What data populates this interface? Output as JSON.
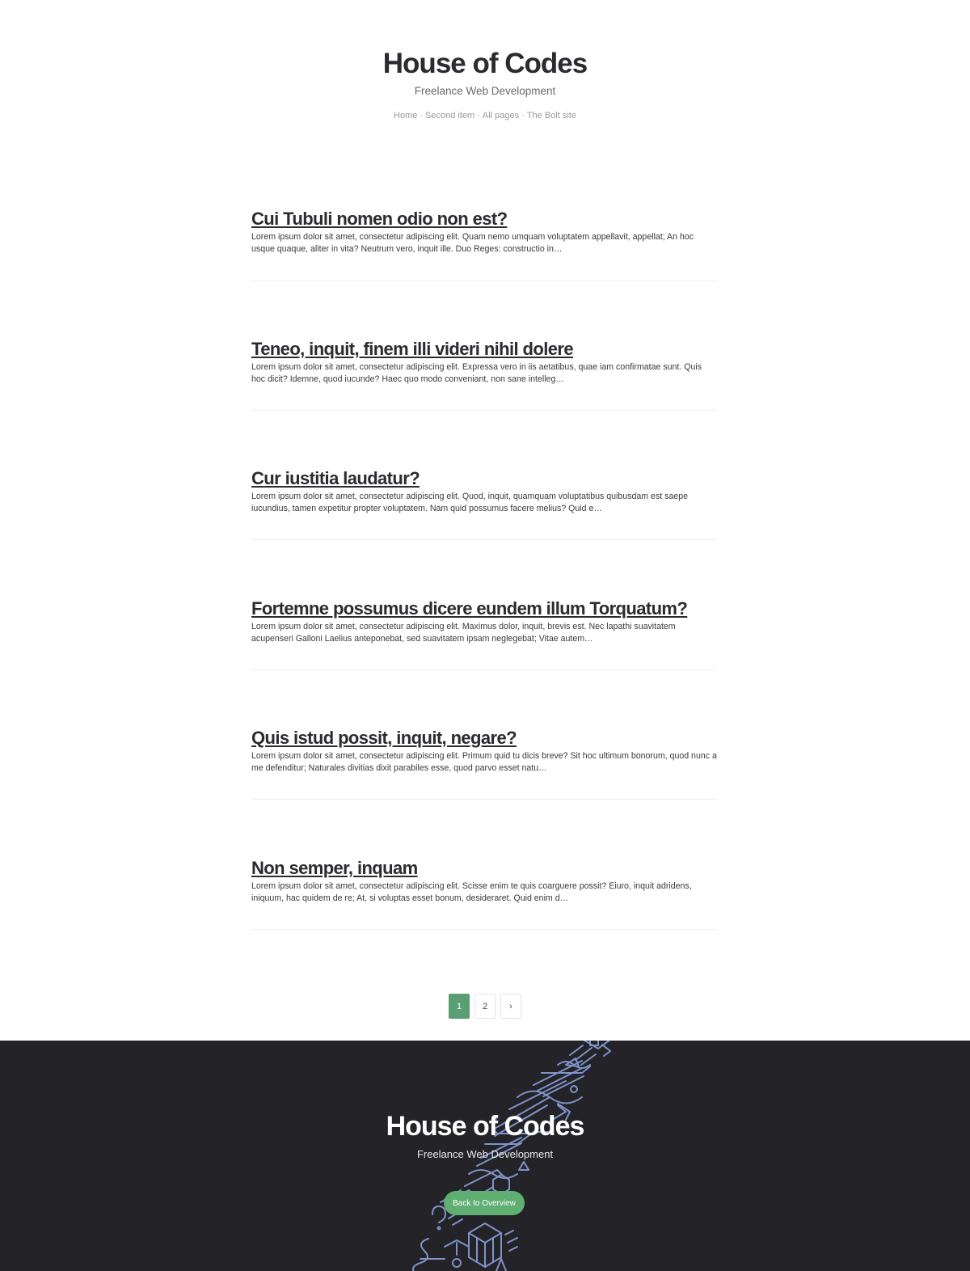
{
  "header": {
    "title": "House of Codes",
    "tagline": "Freelance Web Development",
    "nav": [
      "Home",
      "Second item",
      "All pages",
      "The Bolt site"
    ],
    "nav_separator": "·"
  },
  "posts": [
    {
      "title": "Cui Tubuli nomen odio non est?",
      "excerpt": "Lorem ipsum dolor sit amet, consectetur adipiscing elit. Quam nemo umquam voluptatem appellavit, appellat; An hoc usque quaque, aliter in vita? Neutrum vero, inquit ille. Duo Reges: constructio in…"
    },
    {
      "title": "Teneo, inquit, finem illi videri nihil dolere",
      "excerpt": "Lorem ipsum dolor sit amet, consectetur adipiscing elit. Expressa vero in iis aetatibus, quae iam confirmatae sunt. Quis hoc dicit? Idemne, quod iucunde? Haec quo modo conveniant, non sane intelleg…"
    },
    {
      "title": "Cur iustitia laudatur?",
      "excerpt": "Lorem ipsum dolor sit amet, consectetur adipiscing elit. Quod, inquit, quamquam voluptatibus quibusdam est saepe iucundius, tamen expetitur propter voluptatem. Nam quid possumus facere melius? Quid e…"
    },
    {
      "title": "Fortemne possumus dicere eundem illum Torquatum?",
      "excerpt": "Lorem ipsum dolor sit amet, consectetur adipiscing elit. Maximus dolor, inquit, brevis est. Nec lapathi suavitatem acupenseri Galloni Laelius anteponebat, sed suavitatem ipsam neglegebat; Vitae autem…"
    },
    {
      "title": "Quis istud possit, inquit, negare?",
      "excerpt": "Lorem ipsum dolor sit amet, consectetur adipiscing elit. Primum quid tu dicis breve? Sit hoc ultimum bonorum, quod nunc a me defenditur; Naturales divitias dixit parabiles esse, quod parvo esset natu…"
    },
    {
      "title": "Non semper, inquam",
      "excerpt": "Lorem ipsum dolor sit amet, consectetur adipiscing elit. Scisse enim te quis coarguere possit? Eiuro, inquit adridens, iniquum, hac quidem de re; At, si voluptas esset bonum, desideraret. Quid enim d…"
    }
  ],
  "pagination": {
    "pages": [
      "1",
      "2"
    ],
    "current": "1",
    "next_label": "›"
  },
  "footer": {
    "title": "House of Codes",
    "tagline": "Freelance Web Development",
    "back_button": "Back to Overview"
  },
  "colors": {
    "accent": "#5a9f73",
    "footer_bg": "#232328",
    "footer_art": "#7f93c8"
  }
}
